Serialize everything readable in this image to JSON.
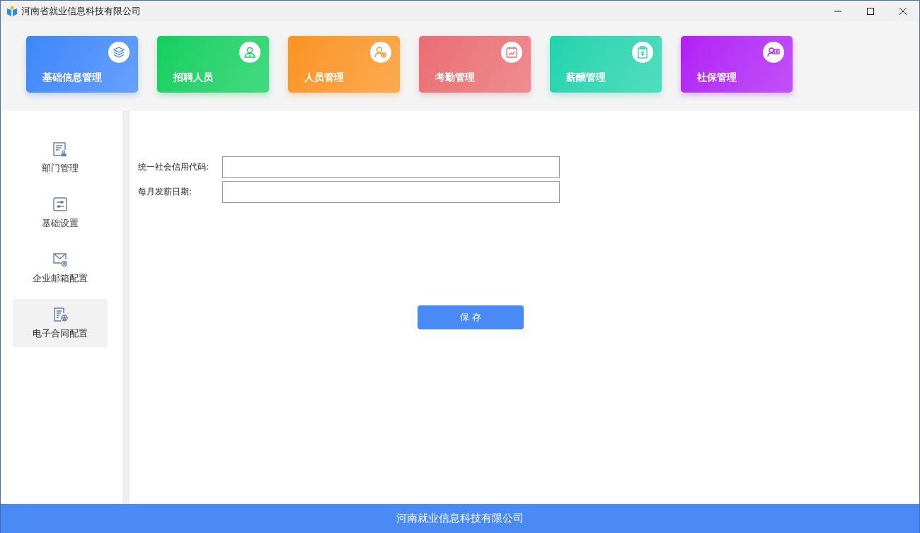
{
  "window": {
    "title": "河南省就业信息科技有限公司"
  },
  "modules": [
    {
      "label": "基础信息管理",
      "color": "#3d86fb"
    },
    {
      "label": "招聘人员",
      "color": "#0ecf5e"
    },
    {
      "label": "人员管理",
      "color": "#fb9320"
    },
    {
      "label": "考勤管理",
      "color": "#e96d72"
    },
    {
      "label": "薪酬管理",
      "color": "#1ed3ad"
    },
    {
      "label": "社保管理",
      "color": "#b11ef6"
    }
  ],
  "sidebar": {
    "items": [
      {
        "label": "部门管理",
        "selected": false
      },
      {
        "label": "基础设置",
        "selected": false
      },
      {
        "label": "企业邮箱配置",
        "selected": false
      },
      {
        "label": "电子合同配置",
        "selected": true
      }
    ]
  },
  "form": {
    "fields": [
      {
        "label": "统一社会信用代码:"
      },
      {
        "label": "每月发薪日期:"
      }
    ],
    "save_button": "保 存"
  },
  "status_bar": "河南就业信息科技有限公司"
}
